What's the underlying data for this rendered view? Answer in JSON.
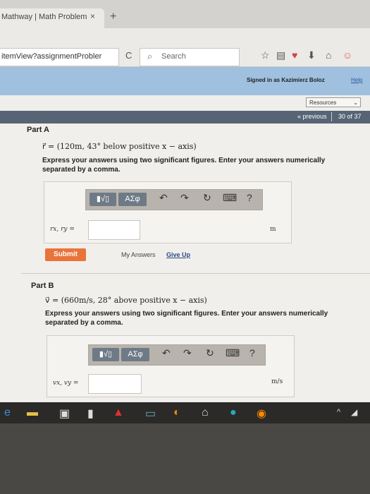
{
  "browser": {
    "tab_title": "Mathway | Math Problem",
    "tab_close": "×",
    "tab_new": "+",
    "url_text": "itemView?assignmentProbler",
    "search_placeholder": "Search",
    "reload_icon": "C"
  },
  "header": {
    "signed_in": "Signed in as Kazimierz Boloz",
    "help": "Help",
    "resources": "Resources",
    "previous": "« previous",
    "page_count": "30 of 37"
  },
  "partA": {
    "title": "Part A",
    "equation": "r⃗ = (120m, 43° below positive x − axis)",
    "instructions": "Express your answers using two significant figures. Enter your answers numerically separated by a comma.",
    "input_label": "rx, ry =",
    "unit": "m",
    "submit": "Submit",
    "my_answers": "My Answers",
    "give_up": "Give Up"
  },
  "partB": {
    "title": "Part B",
    "equation": "v⃗ = (660m/s, 28° above positive x − axis)",
    "instructions": "Express your answers using two significant figures. Enter your answers numerically separated by a comma.",
    "input_label": "vx, vy =",
    "unit": "m/s"
  },
  "toolbar": {
    "template_btn": "▮√▯",
    "greek_btn": "ΑΣφ",
    "undo": "↶",
    "redo": "↷",
    "reset": "↻",
    "keyboard": "⌨",
    "help": "?"
  }
}
